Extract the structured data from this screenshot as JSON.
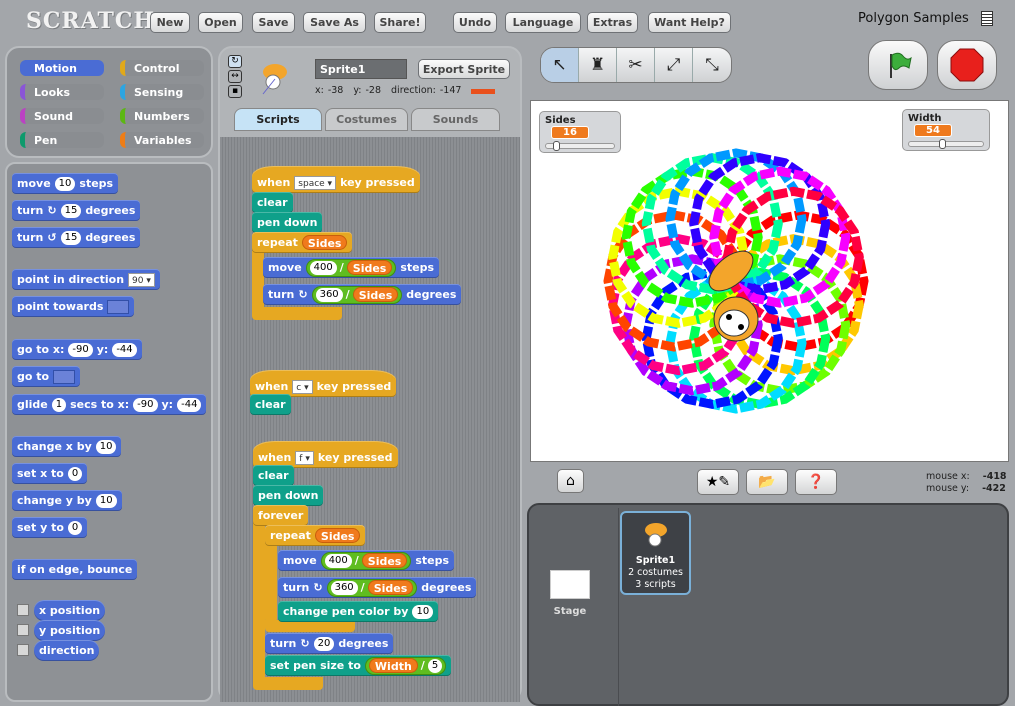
{
  "app": {
    "logo": "SCRATCH",
    "project_title": "Polygon Samples"
  },
  "menu": [
    "New",
    "Open",
    "Save",
    "Save As",
    "Share!",
    "Undo",
    "Language",
    "Extras",
    "Want Help?"
  ],
  "categories": [
    {
      "label": "Motion",
      "color": "#4a6cd4"
    },
    {
      "label": "Control",
      "color": "#e1a91a"
    },
    {
      "label": "Looks",
      "color": "#8a55d7"
    },
    {
      "label": "Sensing",
      "color": "#2ca5e2"
    },
    {
      "label": "Sound",
      "color": "#bb42c3"
    },
    {
      "label": "Numbers",
      "color": "#5cb712"
    },
    {
      "label": "Pen",
      "color": "#0e9a6c"
    },
    {
      "label": "Variables",
      "color": "#ee7d16"
    }
  ],
  "selected_category": "Motion",
  "sprite": {
    "name": "Sprite1",
    "export_label": "Export Sprite",
    "x_label": "x:",
    "x": "-38",
    "y_label": "y:",
    "y": "-28",
    "direction_label": "direction:",
    "direction": "-147"
  },
  "tabs": [
    "Scripts",
    "Costumes",
    "Sounds"
  ],
  "active_tab": "Scripts",
  "palette": [
    {
      "c": "m",
      "p": [
        [
          "t",
          "move"
        ],
        [
          "n",
          "10"
        ],
        [
          "t",
          "steps"
        ]
      ]
    },
    {
      "c": "m",
      "p": [
        [
          "t",
          "turn"
        ],
        [
          "i",
          "↻"
        ],
        [
          "n",
          "15"
        ],
        [
          "t",
          "degrees"
        ]
      ]
    },
    {
      "c": "m",
      "p": [
        [
          "t",
          "turn"
        ],
        [
          "i",
          "↺"
        ],
        [
          "n",
          "15"
        ],
        [
          "t",
          "degrees"
        ]
      ]
    },
    {
      "c": "m",
      "p": [
        [
          "t",
          "point in direction"
        ],
        [
          "d",
          "90 ▾"
        ]
      ]
    },
    {
      "c": "m",
      "p": [
        [
          "t",
          "point towards"
        ],
        [
          "e",
          ""
        ]
      ]
    },
    {
      "c": "m",
      "p": [
        [
          "t",
          "go to x:"
        ],
        [
          "n",
          "-90"
        ],
        [
          "t",
          "y:"
        ],
        [
          "n",
          "-44"
        ]
      ]
    },
    {
      "c": "m",
      "p": [
        [
          "t",
          "go to"
        ],
        [
          "e",
          ""
        ]
      ]
    },
    {
      "c": "m",
      "p": [
        [
          "t",
          "glide"
        ],
        [
          "n",
          "1"
        ],
        [
          "t",
          "secs to x:"
        ],
        [
          "n",
          "-90"
        ],
        [
          "t",
          "y:"
        ],
        [
          "n",
          "-44"
        ]
      ]
    },
    {
      "c": "m",
      "p": [
        [
          "t",
          "change x by"
        ],
        [
          "n",
          "10"
        ]
      ]
    },
    {
      "c": "m",
      "p": [
        [
          "t",
          "set x to"
        ],
        [
          "n",
          "0"
        ]
      ]
    },
    {
      "c": "m",
      "p": [
        [
          "t",
          "change y by"
        ],
        [
          "n",
          "10"
        ]
      ]
    },
    {
      "c": "m",
      "p": [
        [
          "t",
          "set y to"
        ],
        [
          "n",
          "0"
        ]
      ]
    },
    {
      "c": "m",
      "p": [
        [
          "t",
          "if on edge, bounce"
        ]
      ]
    },
    {
      "c": "m",
      "r": 1,
      "p": [
        [
          "t",
          "x position"
        ]
      ]
    },
    {
      "c": "m",
      "r": 1,
      "p": [
        [
          "t",
          "y position"
        ]
      ]
    },
    {
      "c": "m",
      "r": 1,
      "p": [
        [
          "t",
          "direction"
        ]
      ]
    }
  ],
  "scripts": [
    {
      "c": "c",
      "h": 1,
      "p": [
        [
          "t",
          "when"
        ],
        [
          "d",
          "space ▾"
        ],
        [
          "t",
          "key pressed"
        ]
      ]
    },
    {
      "c": "p",
      "p": [
        [
          "t",
          "clear"
        ]
      ]
    },
    {
      "c": "p",
      "p": [
        [
          "t",
          "pen down"
        ]
      ]
    },
    {
      "c": "c",
      "p": [
        [
          "t",
          "repeat"
        ],
        [
          "v",
          "Sides"
        ]
      ]
    },
    {
      "c": "m",
      "p": [
        [
          "t",
          "move"
        ],
        [
          "o",
          "400",
          "Sides"
        ],
        [
          "t",
          "steps"
        ]
      ]
    },
    {
      "c": "m",
      "p": [
        [
          "t",
          "turn"
        ],
        [
          "i",
          "↻"
        ],
        [
          "o",
          "360",
          "Sides"
        ],
        [
          "t",
          "degrees"
        ]
      ]
    },
    {
      "c": "c",
      "h": 1,
      "p": [
        [
          "t",
          "when"
        ],
        [
          "d",
          "c ▾"
        ],
        [
          "t",
          "key pressed"
        ]
      ]
    },
    {
      "c": "p",
      "p": [
        [
          "t",
          "clear"
        ]
      ]
    },
    {
      "c": "c",
      "h": 1,
      "p": [
        [
          "t",
          "when"
        ],
        [
          "d",
          "f ▾"
        ],
        [
          "t",
          "key pressed"
        ]
      ]
    },
    {
      "c": "p",
      "p": [
        [
          "t",
          "clear"
        ]
      ]
    },
    {
      "c": "p",
      "p": [
        [
          "t",
          "pen down"
        ]
      ]
    },
    {
      "c": "c",
      "p": [
        [
          "t",
          "forever"
        ]
      ]
    },
    {
      "c": "c",
      "p": [
        [
          "t",
          "repeat"
        ],
        [
          "v",
          "Sides"
        ]
      ]
    },
    {
      "c": "m",
      "p": [
        [
          "t",
          "move"
        ],
        [
          "o",
          "400",
          "Sides"
        ],
        [
          "t",
          "steps"
        ]
      ]
    },
    {
      "c": "m",
      "p": [
        [
          "t",
          "turn"
        ],
        [
          "i",
          "↻"
        ],
        [
          "o",
          "360",
          "Sides"
        ],
        [
          "t",
          "degrees"
        ]
      ]
    },
    {
      "c": "p",
      "p": [
        [
          "t",
          "change pen color by"
        ],
        [
          "n",
          "10"
        ]
      ]
    },
    {
      "c": "m",
      "p": [
        [
          "t",
          "turn"
        ],
        [
          "i",
          "↻"
        ],
        [
          "n",
          "20"
        ],
        [
          "t",
          "degrees"
        ]
      ]
    },
    {
      "c": "p",
      "p": [
        [
          "t",
          "set pen size to"
        ],
        [
          "o",
          "Width",
          "5"
        ]
      ]
    }
  ],
  "operator_symbol": "/",
  "stage": {
    "monitors": [
      {
        "label": "Sides",
        "value": "16",
        "level": 0.1
      },
      {
        "label": "Width",
        "value": "54",
        "level": 0.4
      }
    ]
  },
  "mouse": {
    "x_label": "mouse x:",
    "x": "-418",
    "y_label": "mouse y:",
    "y": "-422"
  },
  "sprites_pane": {
    "stage_label": "Stage",
    "sprites": [
      {
        "name": "Sprite1",
        "costumes": "2 costumes",
        "scripts": "3 scripts"
      }
    ]
  },
  "colors": {
    "motion": "#4a6cd4",
    "control": "#e6a822",
    "pen": "#0e9a6c",
    "operators": "#5fbd20",
    "variables": "#f07a1c"
  }
}
